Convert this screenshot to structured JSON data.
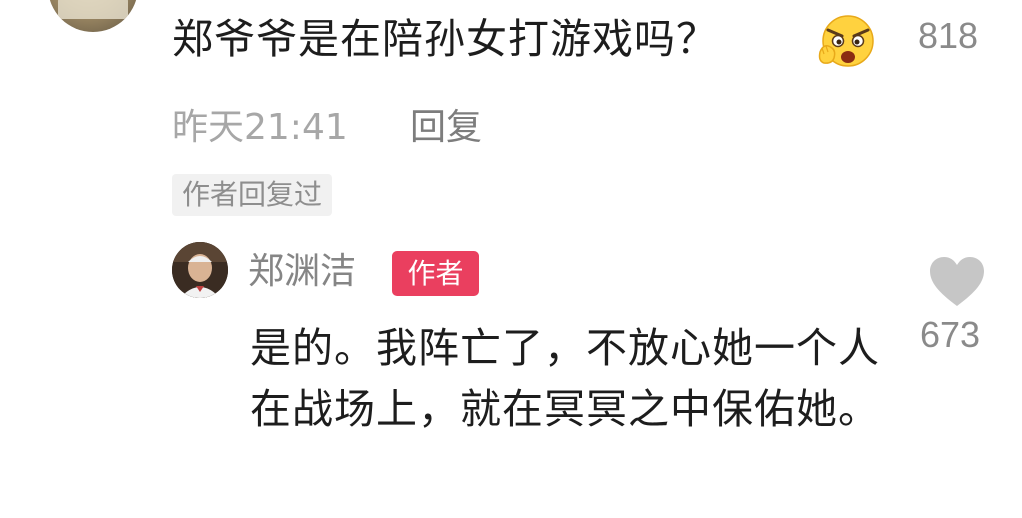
{
  "comment": {
    "text": "郑爷爷是在陪孙女打游戏吗？",
    "like_count": "818",
    "time": "昨天21:41",
    "reply_label": "回复",
    "author_replied_label": "作者回复过"
  },
  "reply": {
    "author_name": "郑渊洁",
    "author_badge": "作者",
    "text": "是的。我阵亡了，不放心她一个人在战场上，就在冥冥之中保佑她。",
    "like_count": "673"
  },
  "colors": {
    "badge": "#ea3f5f",
    "text": "#1d1d1d",
    "meta": "#a7a7a7"
  },
  "icons": {
    "emoji": "surprised-face-emoji-icon",
    "like": "heart-icon"
  }
}
